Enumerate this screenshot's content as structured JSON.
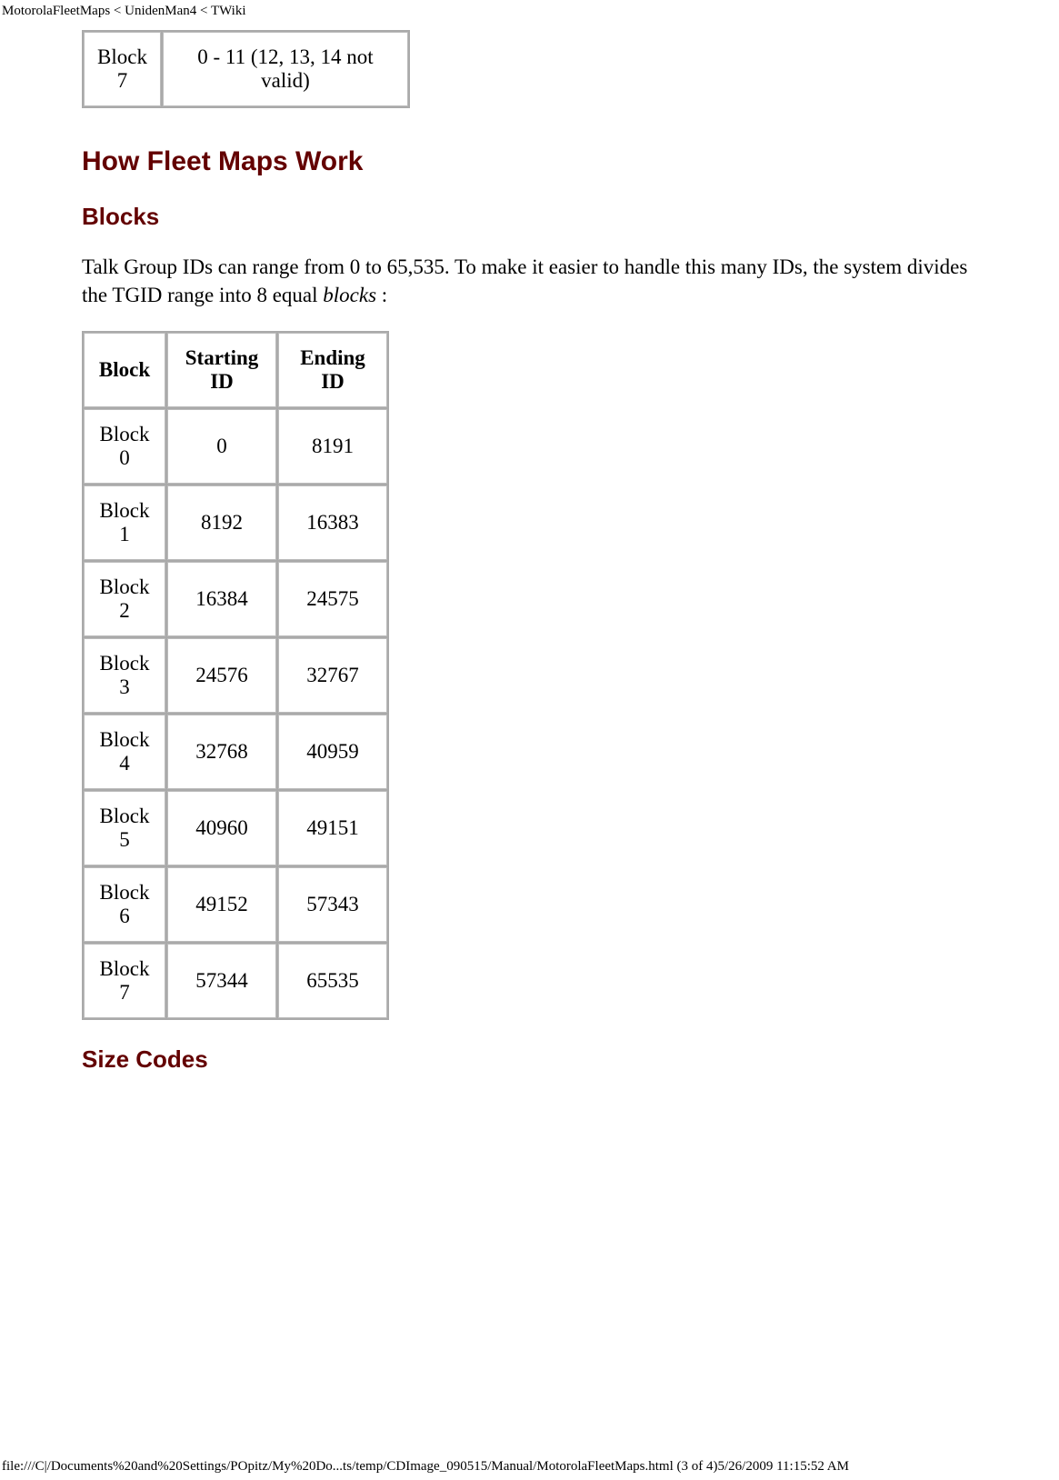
{
  "header_path": "MotorolaFleetMaps < UnidenMan4 < TWiki",
  "footer_path": "file:///C|/Documents%20and%20Settings/POpitz/My%20Do...ts/temp/CDImage_090515/Manual/MotorolaFleetMaps.html (3 of 4)5/26/2009 11:15:52 AM",
  "top_row": {
    "label": "Block 7",
    "value": "0 - 11 (12, 13, 14 not valid)"
  },
  "heading_main": "How Fleet Maps Work",
  "heading_blocks": "Blocks",
  "paragraph_blocks_pre": "Talk Group IDs can range from 0 to 65,535. To make it easier to handle this many IDs, the system divides the TGID range into 8 equal ",
  "paragraph_blocks_em": "blocks",
  "paragraph_blocks_post": " :",
  "blocks_table": {
    "headers": {
      "block": "Block",
      "start": "Starting ID",
      "end": "Ending ID"
    },
    "rows": [
      {
        "block": "Block 0",
        "start": "0",
        "end": "8191"
      },
      {
        "block": "Block 1",
        "start": "8192",
        "end": "16383"
      },
      {
        "block": "Block 2",
        "start": "16384",
        "end": "24575"
      },
      {
        "block": "Block 3",
        "start": "24576",
        "end": "32767"
      },
      {
        "block": "Block 4",
        "start": "32768",
        "end": "40959"
      },
      {
        "block": "Block 5",
        "start": "40960",
        "end": "49151"
      },
      {
        "block": "Block 6",
        "start": "49152",
        "end": "57343"
      },
      {
        "block": "Block 7",
        "start": "57344",
        "end": "65535"
      }
    ]
  },
  "heading_size_codes": "Size Codes"
}
